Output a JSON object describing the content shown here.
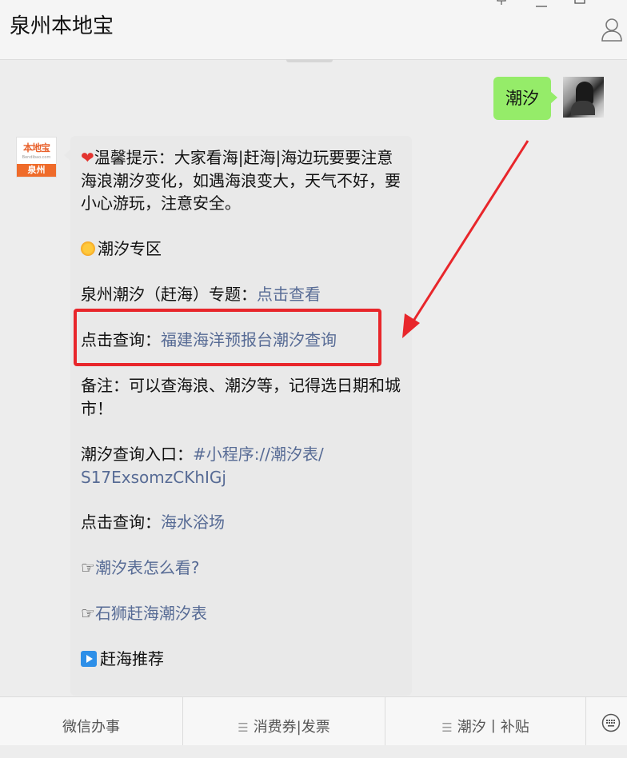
{
  "app": {
    "title": "泉州本地宝",
    "window_controls": [
      "pin-icon",
      "minimize-icon",
      "maximize-icon"
    ]
  },
  "outgoing_message": {
    "text": "潮汐",
    "bubble_color": "#95ec69"
  },
  "official_account": {
    "avatar_top": "本地宝",
    "avatar_sub": "Bendibao.com",
    "avatar_bottom": "泉州"
  },
  "incoming_message": {
    "tip": "温馨提示：大家看海|赶海|海边玩要要注意海浪潮汐变化，如遇海浪变大，天气不好，要小心游玩，注意安全。",
    "section_title": "潮汐专区",
    "topic_label": "泉州潮汐（赶海）专题：",
    "topic_link": "点击查看",
    "query_label": "点击查询：",
    "query_link": "福建海洋预报台潮汐查询",
    "note": "备注：可以查海浪、潮汐等，记得选日期和城市！",
    "entry_label": "潮汐查询入口：",
    "entry_link_line1": "#小程序://潮汐表/",
    "entry_link_line2": "S17ExsomzCKhIGj",
    "query2_label": "点击查询：",
    "query2_link": "海水浴场",
    "pointer_symbol": "☞",
    "link_howto": "潮汐表怎么看?",
    "link_shishi": "石狮赶海潮汐表",
    "recommend": "赶海推荐"
  },
  "bottom_menu": {
    "items": [
      {
        "label": "微信办事"
      },
      {
        "label": "消费券|发票"
      },
      {
        "label": "潮汐丨补贴"
      }
    ],
    "hamburger": "☰"
  },
  "colors": {
    "link": "#576b95",
    "annotation": "#e8262b",
    "background": "#ededed"
  }
}
